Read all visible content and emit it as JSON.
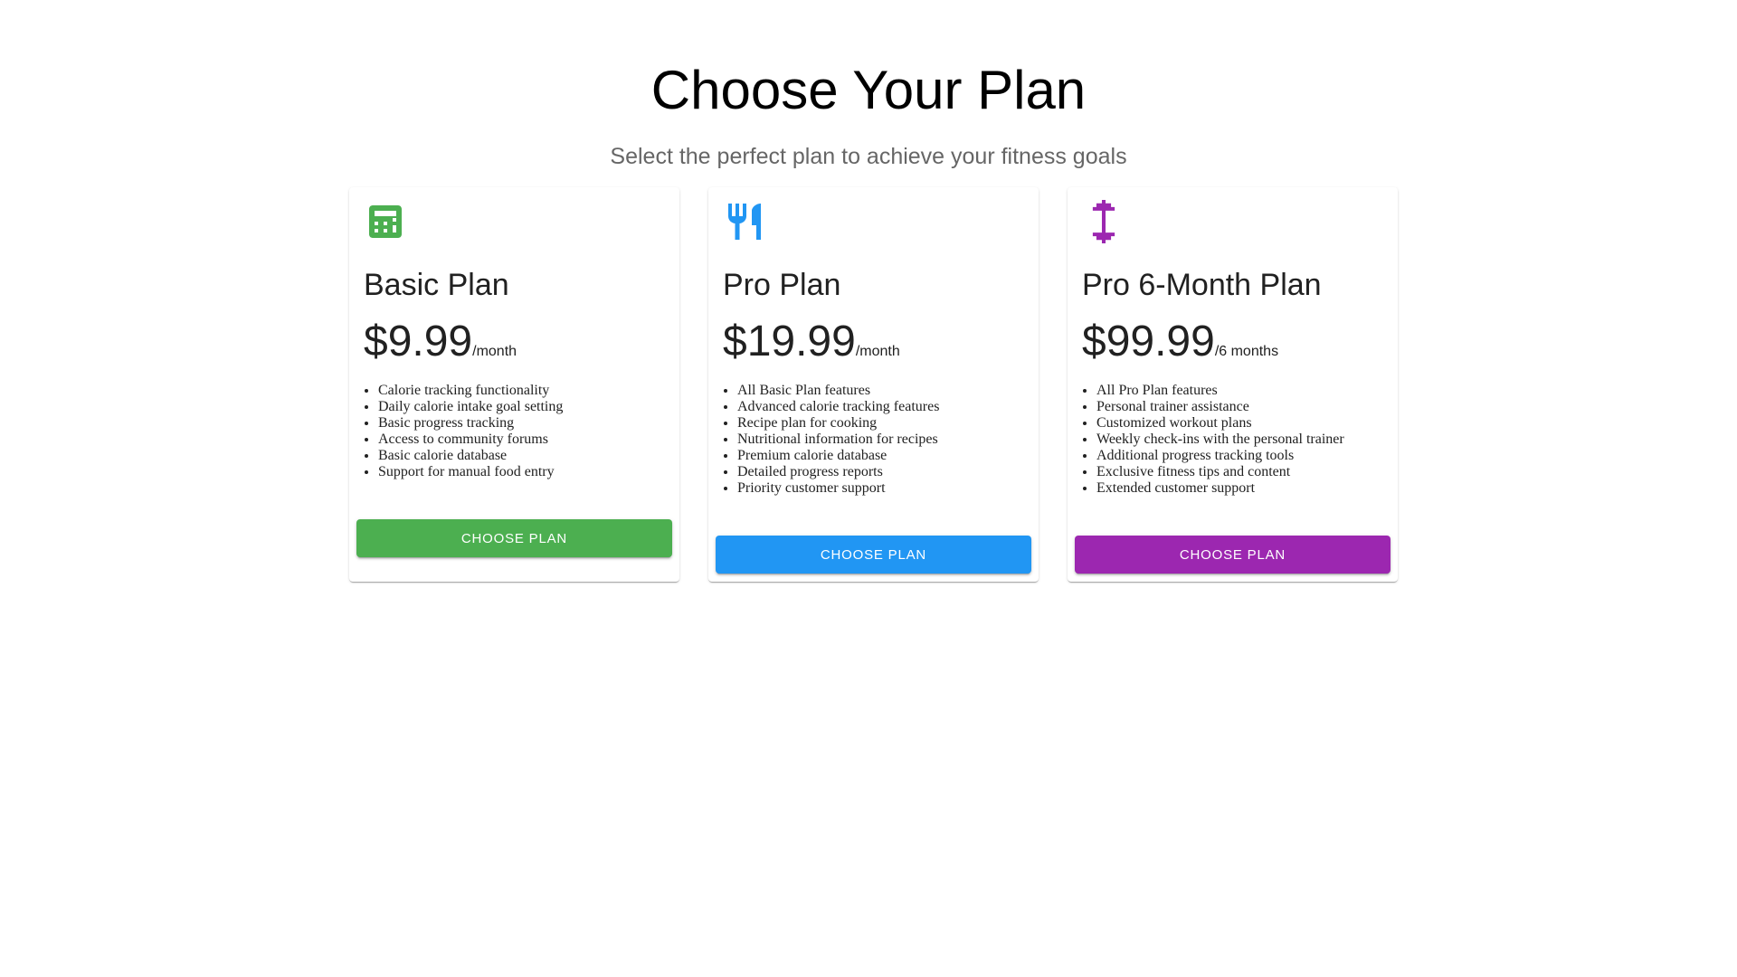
{
  "header": {
    "title": "Choose Your Plan",
    "subtitle": "Select the perfect plan to achieve your fitness goals"
  },
  "plans": [
    {
      "icon": "calculator-icon",
      "color": "#4caf50",
      "name": "Basic Plan",
      "price": "$9.99",
      "period": "/month",
      "features": [
        "Calorie tracking functionality",
        "Daily calorie intake goal setting",
        "Basic progress tracking",
        "Access to community forums",
        "Basic calorie database",
        "Support for manual food entry"
      ],
      "button_label": "Choose Plan"
    },
    {
      "icon": "restaurant-icon",
      "color": "#2196f3",
      "name": "Pro Plan",
      "price": "$19.99",
      "period": "/month",
      "features": [
        "All Basic Plan features",
        "Advanced calorie tracking features",
        "Recipe plan for cooking",
        "Nutritional information for recipes",
        "Premium calorie database",
        "Detailed progress reports",
        "Priority customer support"
      ],
      "button_label": "Choose Plan"
    },
    {
      "icon": "dumbbell-icon",
      "color": "#9c27b0",
      "name": "Pro 6-Month Plan",
      "price": "$99.99",
      "period": "/6 months",
      "features": [
        "All Pro Plan features",
        "Personal trainer assistance",
        "Customized workout plans",
        "Weekly check-ins with the personal trainer",
        "Additional progress tracking tools",
        "Exclusive fitness tips and content",
        "Extended customer support"
      ],
      "button_label": "Choose Plan"
    }
  ]
}
